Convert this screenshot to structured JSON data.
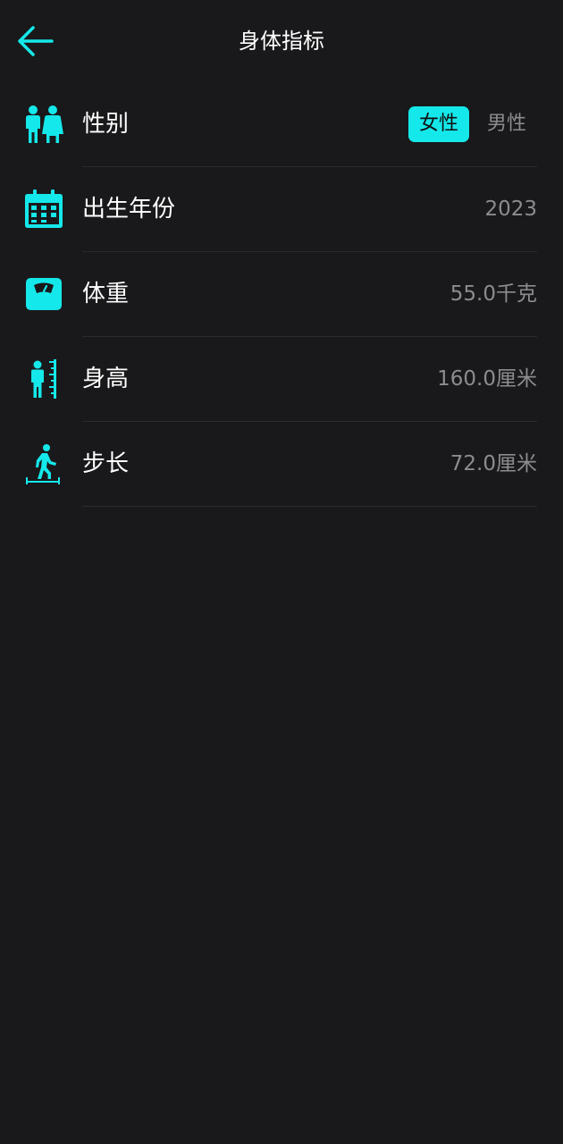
{
  "header": {
    "title": "身体指标"
  },
  "colors": {
    "accent": "#15e8ea",
    "background": "#19191b",
    "muted_text": "#8c8c8f"
  },
  "rows": {
    "gender": {
      "label": "性别",
      "icon": "couple-icon",
      "options": [
        "女性",
        "男性"
      ],
      "selected": "女性"
    },
    "birth_year": {
      "label": "出生年份",
      "icon": "calendar-icon",
      "value": "2023"
    },
    "weight": {
      "label": "体重",
      "icon": "scale-icon",
      "value": "55.0千克"
    },
    "height": {
      "label": "身高",
      "icon": "height-ruler-icon",
      "value": "160.0厘米"
    },
    "stride": {
      "label": "步长",
      "icon": "walking-icon",
      "value": "72.0厘米"
    }
  }
}
